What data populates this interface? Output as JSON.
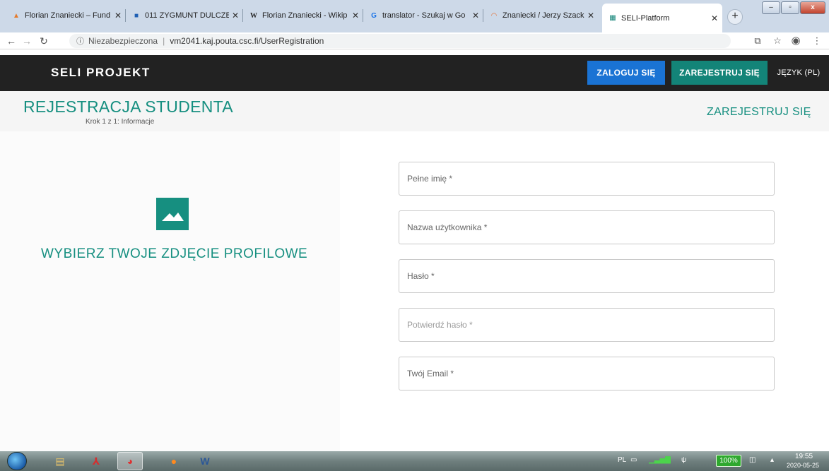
{
  "browser": {
    "tabs": [
      {
        "title": "Florian Znaniecki – Fund",
        "favicon": "blogger-icon",
        "color": "#e57a2b"
      },
      {
        "title": "011 ZYGMUNT DULCZEW",
        "favicon": "puzzle-icon",
        "color": "#1f5fb3"
      },
      {
        "title": "Florian Znaniecki - Wikip",
        "favicon": "W",
        "color": "#222222"
      },
      {
        "title": "translator - Szukaj w Go",
        "favicon": "G",
        "color": "#1a73e8"
      },
      {
        "title": "Znaniecki / Jerzy Szacki",
        "favicon": "arc-icon",
        "color": "#e66a2a"
      },
      {
        "title": "SELI-Platform",
        "favicon": "grid-icon",
        "color": "#138478"
      }
    ],
    "new_tab": "+",
    "window_buttons": {
      "minimize": "–",
      "maximize": "▫",
      "close": "x"
    },
    "address": {
      "security": "Niezabezpieczona",
      "url": "vm2041.kaj.pouta.csc.fi/UserRegistration"
    }
  },
  "app": {
    "brand": "SELI PROJEKT",
    "login": "ZALOGUJ SIĘ",
    "register": "ZAREJESTRUJ SIĘ",
    "language": "JĘZYK (PL)"
  },
  "subheader": {
    "title": "REJESTRACJA STUDENTA",
    "step": "Krok 1 z 1: Informacje",
    "register_link": "ZAREJESTRUJ SIĘ"
  },
  "profile": {
    "label": "WYBIERZ TWOJE ZDJĘCIE PROFILOWE"
  },
  "form": {
    "full_name": "Pełne imię *",
    "username": "Nazwa użytkownika *",
    "password": "Hasło *",
    "confirm_password": "Potwierdź hasło *",
    "email": "Twój Email *"
  },
  "colors": {
    "accent": "#168f80",
    "login_button": "#1a73d4",
    "register_button": "#138478",
    "header": "#222222"
  },
  "taskbar": {
    "lang": "PL",
    "battery": "100%",
    "time": "19:55",
    "date": "2020-05-25"
  }
}
